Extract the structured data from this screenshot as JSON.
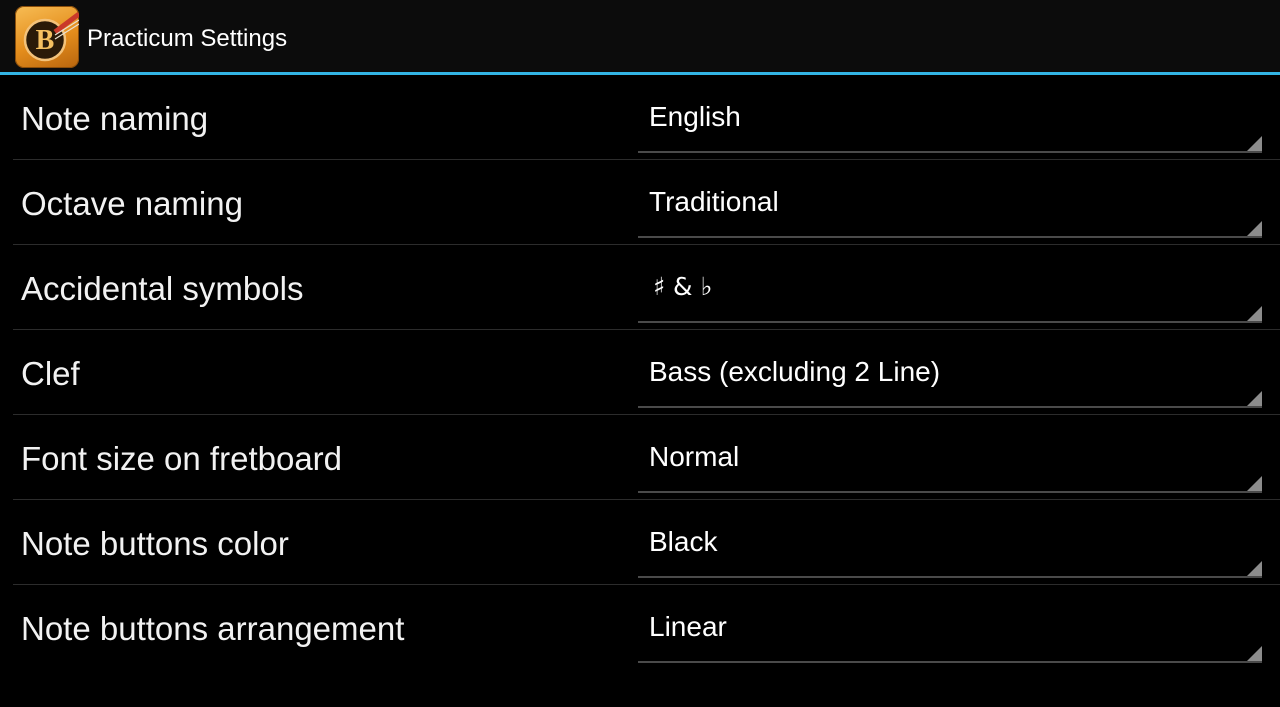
{
  "action_bar": {
    "title": "Practicum Settings",
    "app_icon_letter": "B",
    "divider_color": "#33b5e5"
  },
  "settings": [
    {
      "label": "Note naming",
      "value": "English"
    },
    {
      "label": "Octave naming",
      "value": "Traditional"
    },
    {
      "label": "Accidental symbols",
      "value": "♯ & ♭"
    },
    {
      "label": "Clef",
      "value": "Bass (excluding 2 Line)"
    },
    {
      "label": "Font size on fretboard",
      "value": "Normal"
    },
    {
      "label": "Note buttons color",
      "value": "Black"
    },
    {
      "label": "Note buttons arrangement",
      "value": "Linear"
    }
  ],
  "icons": {
    "app_icon": "bass-guitar-app-icon",
    "spinner_arrow": "dropdown-corner-icon"
  }
}
